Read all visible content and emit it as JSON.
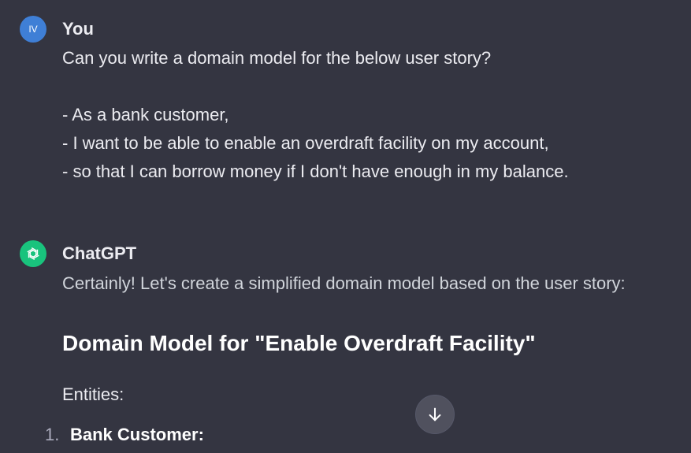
{
  "user_message": {
    "avatar_initials": "IV",
    "author": "You",
    "lines": [
      "Can you write a domain model for the below user story?",
      "",
      "- As a bank customer,",
      "- I want to be able to enable an overdraft facility on my account,",
      "- so that I can borrow money if I don't have enough in my balance."
    ]
  },
  "assistant_message": {
    "avatar_icon": "openai-logo-icon",
    "author": "ChatGPT",
    "intro": "Certainly! Let's create a simplified domain model based on the user story:",
    "heading": "Domain Model for \"Enable Overdraft Facility\"",
    "entities_label": "Entities:",
    "list": [
      {
        "number": "1.",
        "label": "Bank Customer:"
      }
    ]
  },
  "scroll_button": {
    "icon": "arrow-down-icon"
  },
  "colors": {
    "background": "#343541",
    "user_avatar": "#3f7fd6",
    "gpt_avatar": "#19c37d",
    "text": "#ececf1",
    "scroll_button": "#50515e"
  }
}
